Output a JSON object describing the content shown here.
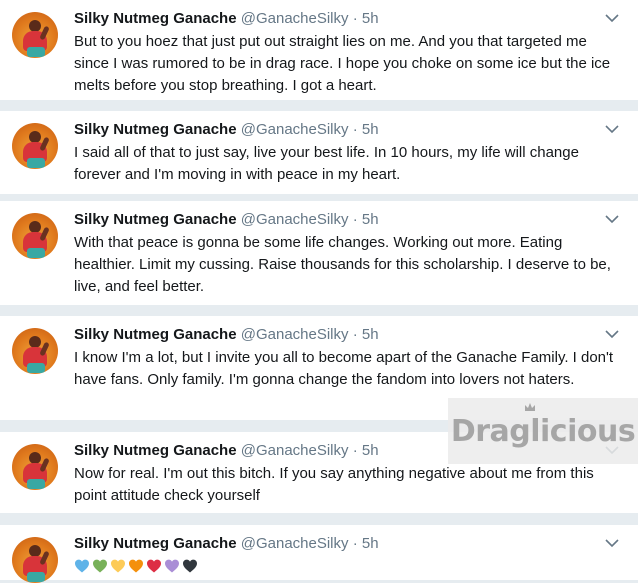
{
  "tweets": [
    {
      "name": "Silky Nutmeg Ganache",
      "handle": "@GanacheSilky",
      "sep": "·",
      "time": "5h",
      "text": "But to you hoez that just put out straight lies on me. And you that targeted me since I was rumored to be in drag race. I hope you choke on some ice but the ice melts before you stop breathing. I got a heart."
    },
    {
      "name": "Silky Nutmeg Ganache",
      "handle": "@GanacheSilky",
      "sep": "·",
      "time": "5h",
      "text": "I said all of that to just say, live your best life. In 10 hours, my life will change forever and I'm moving in with peace in my heart."
    },
    {
      "name": "Silky Nutmeg Ganache",
      "handle": "@GanacheSilky",
      "sep": "·",
      "time": "5h",
      "text": "With that peace is gonna be some life changes. Working out more. Eating healthier. Limit my cussing. Raise thousands for this scholarship. I deserve to be, live, and feel better."
    },
    {
      "name": "Silky Nutmeg Ganache",
      "handle": "@GanacheSilky",
      "sep": "·",
      "time": "5h",
      "text": "I know I'm a lot, but I invite you all to become apart of the Ganache Family. I don't have fans. Only family. I'm gonna change the fandom into lovers not haters."
    },
    {
      "name": "Silky Nutmeg Ganache",
      "handle": "@GanacheSilky",
      "sep": "·",
      "time": "5h",
      "text": "Now for real. I'm out this bitch. If you say anything negative about me from this point attitude check yourself"
    },
    {
      "name": "Silky Nutmeg Ganache",
      "handle": "@GanacheSilky",
      "sep": "·",
      "time": "5h",
      "hearts": [
        "#5fb3e8",
        "#78b159",
        "#fdcb58",
        "#f4900c",
        "#dd2e44",
        "#aa8ed6",
        "#31373d"
      ]
    }
  ],
  "watermark": "Draglicious",
  "colors": {
    "background": "#e6ecf0",
    "text": "#14171a",
    "secondary": "#657786"
  }
}
